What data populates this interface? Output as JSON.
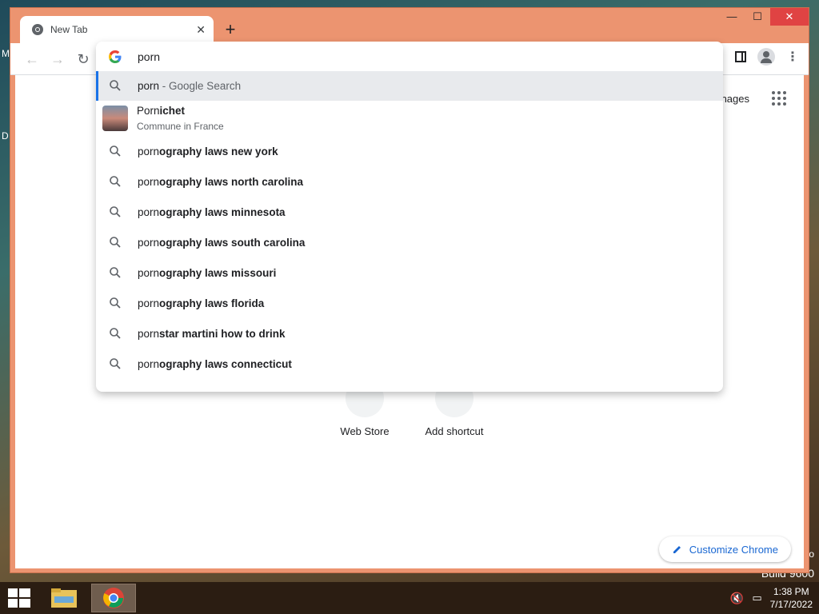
{
  "desktop": {
    "edge_letter_top": "M",
    "edge_letter_mid": "D",
    "edge_letter_low": "o",
    "build": "Build 9600"
  },
  "tab": {
    "title": "New Tab"
  },
  "omnibox": {
    "value": "porn"
  },
  "suggestions": [
    {
      "typed": "porn",
      "rest": "",
      "suffix": " - Google Search",
      "kind": "search",
      "selected": true
    },
    {
      "typed": "Porn",
      "rest": "ichet",
      "sub": "Commune in France",
      "kind": "entity"
    },
    {
      "typed": "porn",
      "rest": "ography laws new york",
      "kind": "search"
    },
    {
      "typed": "porn",
      "rest": "ography laws north carolina",
      "kind": "search"
    },
    {
      "typed": "porn",
      "rest": "ography laws minnesota",
      "kind": "search"
    },
    {
      "typed": "porn",
      "rest": "ography laws south carolina",
      "kind": "search"
    },
    {
      "typed": "porn",
      "rest": "ography laws missouri",
      "kind": "search"
    },
    {
      "typed": "porn",
      "rest": "ography laws florida",
      "kind": "search"
    },
    {
      "typed": "porn",
      "rest": "star martini how to drink",
      "kind": "search"
    },
    {
      "typed": "porn",
      "rest": "ography laws connecticut",
      "kind": "search"
    }
  ],
  "ntp": {
    "images_link": "nages",
    "shortcut_webstore": "Web Store",
    "shortcut_add": "Add shortcut",
    "customize": "Customize Chrome"
  },
  "taskbar": {
    "time": "1:38 PM",
    "date": "7/17/2022"
  },
  "colors": {
    "window_frame": "#ec9470",
    "accent_blue": "#1a73e8",
    "close_red": "#e04343"
  }
}
